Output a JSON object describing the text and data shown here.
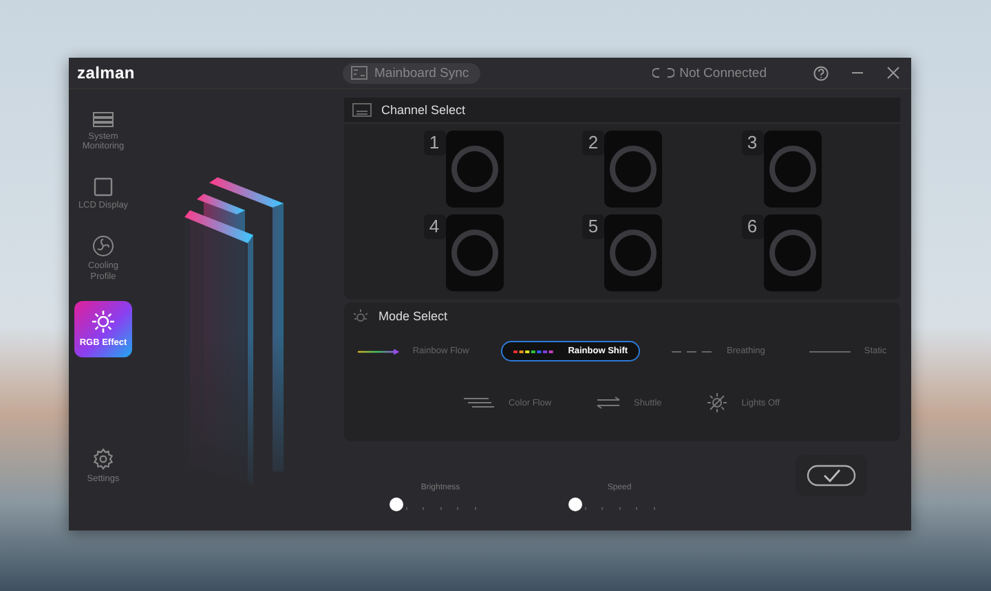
{
  "app": {
    "logo": "zalman"
  },
  "sidebar": {
    "items": [
      {
        "label": "System Monitoring",
        "kind": "monitoring",
        "selected": false
      },
      {
        "label": "LCD Display",
        "kind": "display",
        "selected": false
      },
      {
        "label": "Cooling Profile",
        "kind": "fan",
        "selected": false
      },
      {
        "label": "RGB Effect",
        "kind": "rgb",
        "selected": true
      },
      {
        "label": "Settings",
        "kind": "settings",
        "selected": false
      }
    ]
  },
  "topbar": {
    "sync_button": "Mainboard Sync",
    "connection": "Not Connected"
  },
  "channel_select": {
    "title": "Channel Select",
    "channels": [
      {
        "label": "1",
        "selected": false
      },
      {
        "label": "2",
        "selected": false
      },
      {
        "label": "3",
        "selected": false
      },
      {
        "label": "4",
        "selected": false
      },
      {
        "label": "5",
        "selected": false
      },
      {
        "label": "6",
        "selected": false
      }
    ]
  },
  "mode_select": {
    "title": "Mode Select",
    "rows": [
      {
        "modes": [
          {
            "label": "Rainbow Flow",
            "kind": "rainbow-flow",
            "selected": false
          },
          {
            "label": "Rainbow Shift",
            "kind": "rainbow-shift",
            "selected": true
          },
          {
            "label": "Breathing",
            "kind": "breathing",
            "selected": false
          },
          {
            "label": "Static",
            "kind": "static",
            "selected": false
          }
        ]
      },
      {
        "modes": [
          {
            "label": "Color Flow",
            "kind": "color-flow",
            "selected": false
          },
          {
            "label": "Shuttle",
            "kind": "shuttle",
            "selected": false
          },
          {
            "label": "Lights Off",
            "kind": "lights-off",
            "selected": false
          }
        ]
      }
    ]
  },
  "controls": {
    "sliders": [
      {
        "label": "Brightness",
        "level": 0
      },
      {
        "label": "Speed",
        "level": 0
      }
    ]
  }
}
